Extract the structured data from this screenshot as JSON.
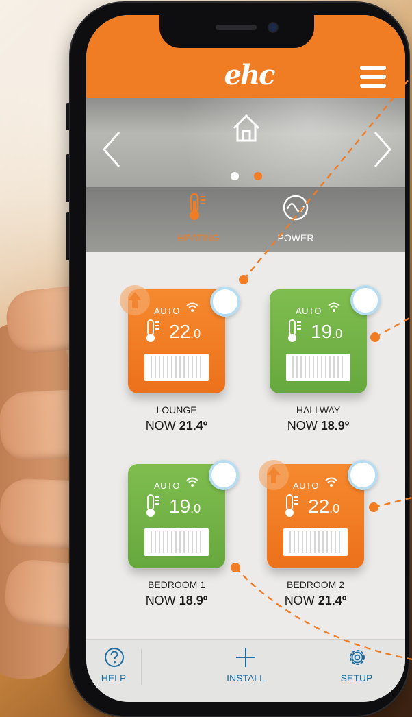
{
  "app": {
    "logo": "ehc"
  },
  "hero": {
    "active_slide": 2,
    "slide_count": 2
  },
  "modes": [
    {
      "label": "HEATING",
      "active": true
    },
    {
      "label": "POWER",
      "active": false
    }
  ],
  "rooms": [
    {
      "name": "LOUNGE",
      "now_prefix": "NOW",
      "now_value": "21.4º",
      "mode": "AUTO",
      "setpoint_int": "22",
      "setpoint_dec": ".0",
      "color": "#f07c24",
      "boost": true
    },
    {
      "name": "HALLWAY",
      "now_prefix": "NOW",
      "now_value": "18.9º",
      "mode": "AUTO",
      "setpoint_int": "19",
      "setpoint_dec": ".0",
      "color": "#72b346",
      "boost": false
    },
    {
      "name": "BEDROOM 1",
      "now_prefix": "NOW",
      "now_value": "18.9º",
      "mode": "AUTO",
      "setpoint_int": "19",
      "setpoint_dec": ".0",
      "color": "#72b346",
      "boost": false
    },
    {
      "name": "BEDROOM 2",
      "now_prefix": "NOW",
      "now_value": "21.4º",
      "mode": "AUTO",
      "setpoint_int": "22",
      "setpoint_dec": ".0",
      "color": "#f07c24",
      "boost": true
    }
  ],
  "bottom_nav": {
    "help": "HELP",
    "install": "INSTALL",
    "setup": "SETUP"
  },
  "colors": {
    "brand_orange": "#f07c24",
    "status_green": "#72b346",
    "link_blue": "#1d6fa5"
  },
  "icons": [
    "home-icon",
    "chevron-left-icon",
    "chevron-right-icon",
    "menu-icon",
    "thermometer-icon",
    "power-wave-icon",
    "wifi-icon",
    "radiator-icon",
    "boost-arrow-icon",
    "help-icon",
    "plus-icon",
    "gear-icon"
  ]
}
